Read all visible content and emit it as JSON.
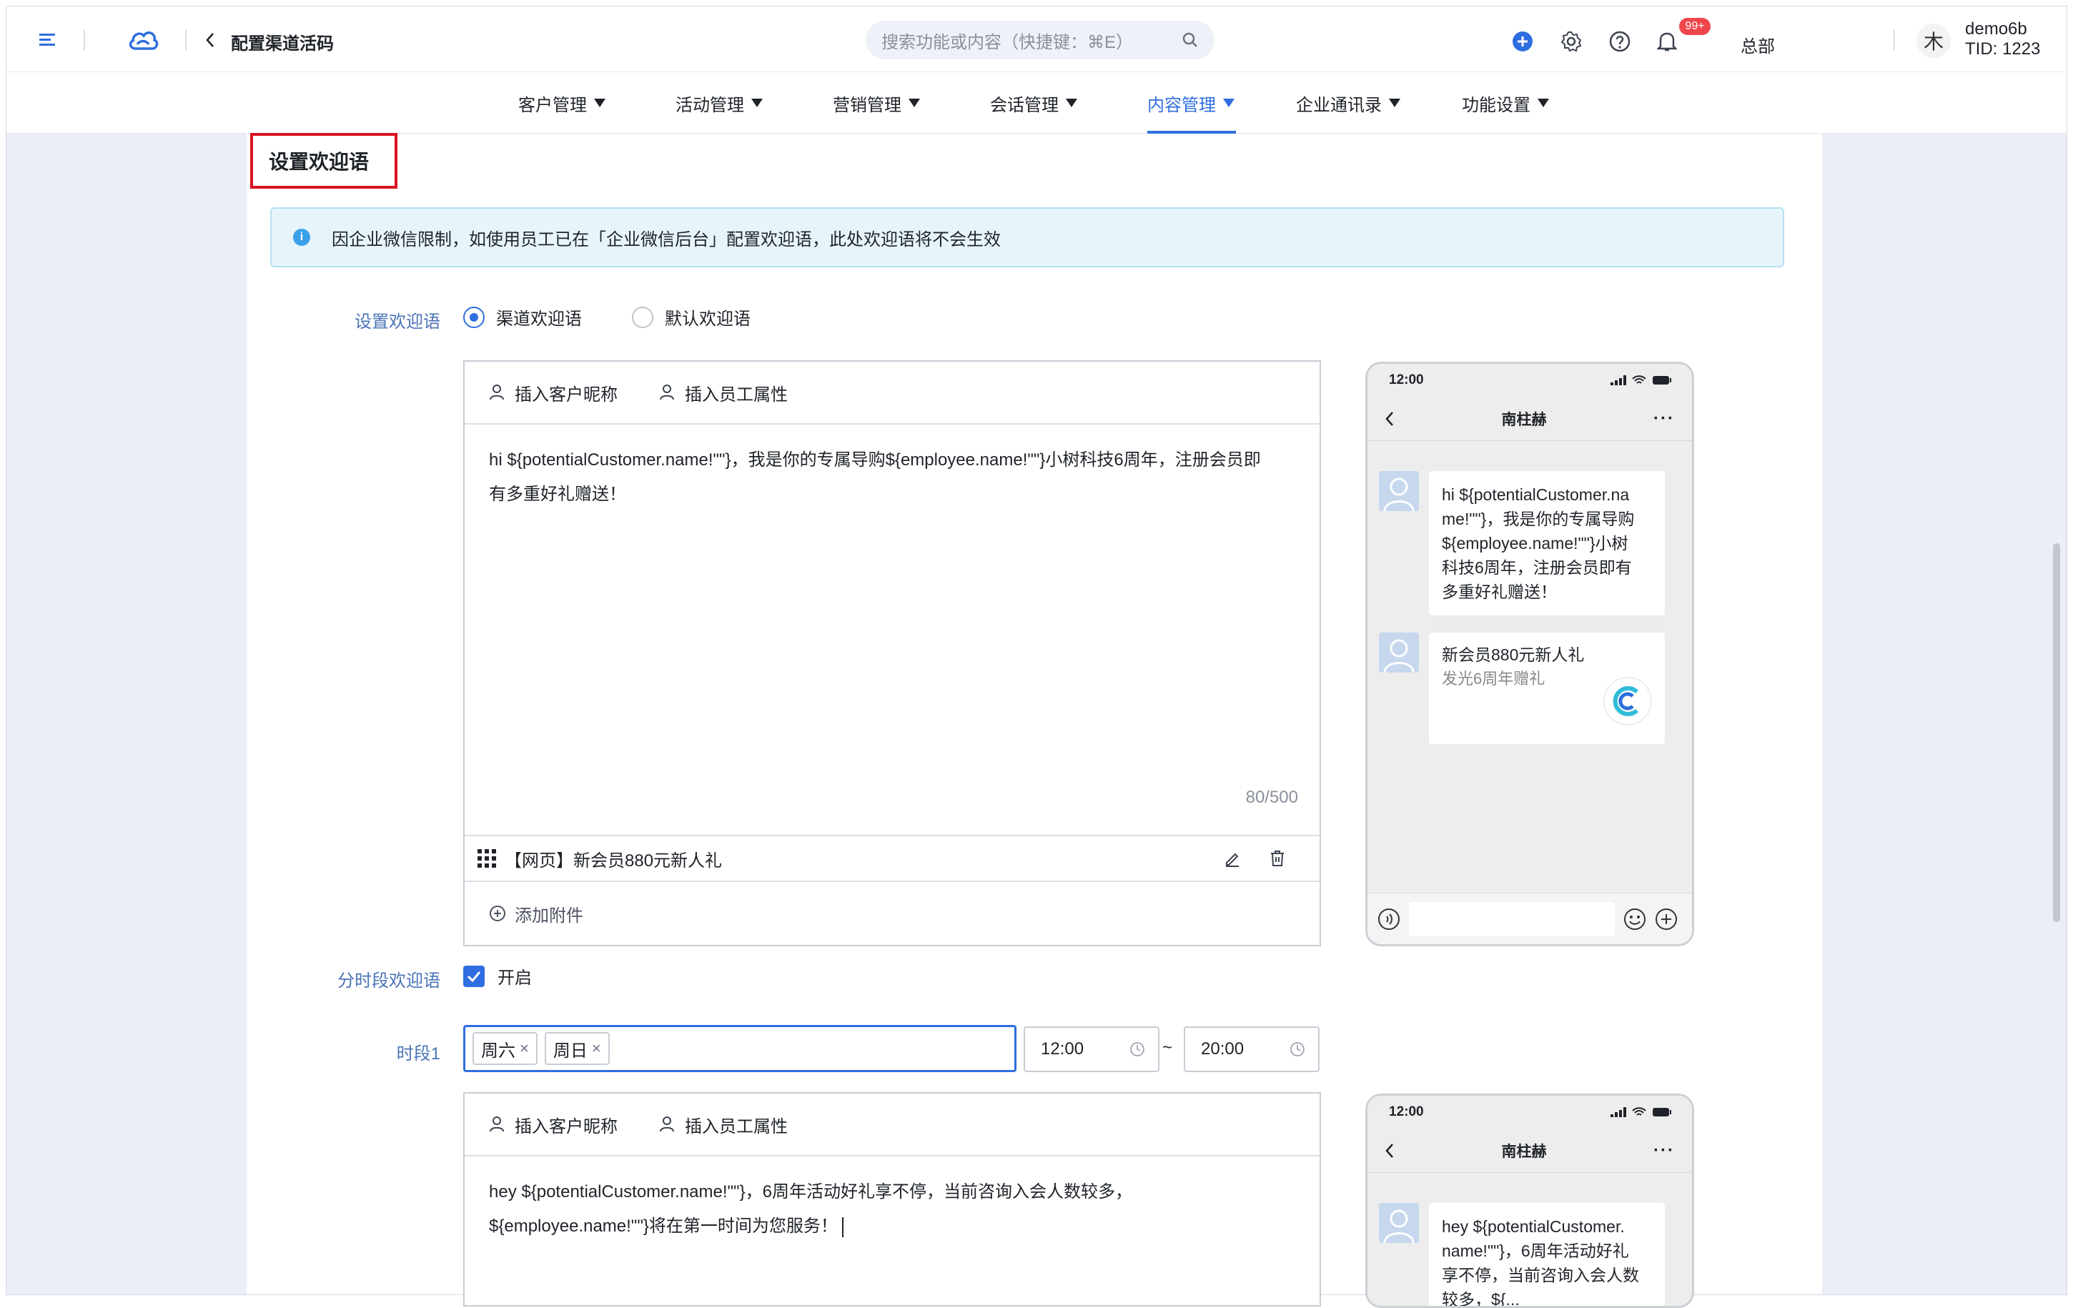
{
  "header": {
    "back_title": "配置渠道活码",
    "search_placeholder": "搜索功能或内容（快捷键：⌘E）",
    "notification_badge": "99+",
    "org_name": "总部",
    "avatar_char": "木",
    "user_name": "demo6b",
    "user_tid": "TID: 1223"
  },
  "nav": {
    "items": [
      {
        "label": "客户管理"
      },
      {
        "label": "活动管理"
      },
      {
        "label": "营销管理"
      },
      {
        "label": "会话管理"
      },
      {
        "label": "内容管理",
        "active": true
      },
      {
        "label": "企业通讯录"
      },
      {
        "label": "功能设置"
      }
    ]
  },
  "section": {
    "title": "设置欢迎语",
    "notice": "因企业微信限制，如使用员工已在「企业微信后台」配置欢迎语，此处欢迎语将不会生效"
  },
  "welcome": {
    "label": "设置欢迎语",
    "option_channel": "渠道欢迎语",
    "option_default": "默认欢迎语",
    "selected": "渠道欢迎语",
    "insert_customer": "插入客户昵称",
    "insert_employee": "插入员工属性",
    "text_line1": "hi ${potentialCustomer.name!\"\"}，我是你的专属导购${employee.name!\"\"}小树科技6周年，注册会员即",
    "text_line2": "有多重好礼赠送！",
    "count": "80/500",
    "attachment": "【网页】新会员880元新人礼",
    "add_attachment": "添加附件"
  },
  "timed": {
    "label": "分时段欢迎语",
    "enabled_label": "开启",
    "enabled": true,
    "period_label": "时段1",
    "days": [
      "周六",
      "周日"
    ],
    "start": "12:00",
    "tilde": "~",
    "end": "20:00",
    "insert_customer": "插入客户昵称",
    "insert_employee": "插入员工属性",
    "text_line1": "hey ${potentialCustomer.name!\"\"}，6周年活动好礼享不停，当前咨询入会人数较多，",
    "text_line2": "${employee.name!\"\"}将在第一时间为您服务！"
  },
  "phone1": {
    "time": "12:00",
    "contact": "南柱赫",
    "bubble_lines": [
      "hi ${potentialCustomer.na",
      "me!\"\"}，我是你的专属导购",
      "${employee.name!\"\"}小树",
      "科技6周年，注册会员即有",
      "多重好礼赠送！"
    ],
    "card_title": "新会员880元新人礼",
    "card_sub": "发光6周年赠礼"
  },
  "phone2": {
    "time": "12:00",
    "contact": "南柱赫",
    "bubble_lines": [
      "hey ${potentialCustomer.",
      "name!\"\"}，6周年活动好礼",
      "享不停，当前咨询入会人数",
      "较多，${..."
    ]
  },
  "colors": {
    "accent": "#2f6ee0",
    "highlight_box": "#d9141f",
    "notice_bg": "#e7f5fb"
  }
}
